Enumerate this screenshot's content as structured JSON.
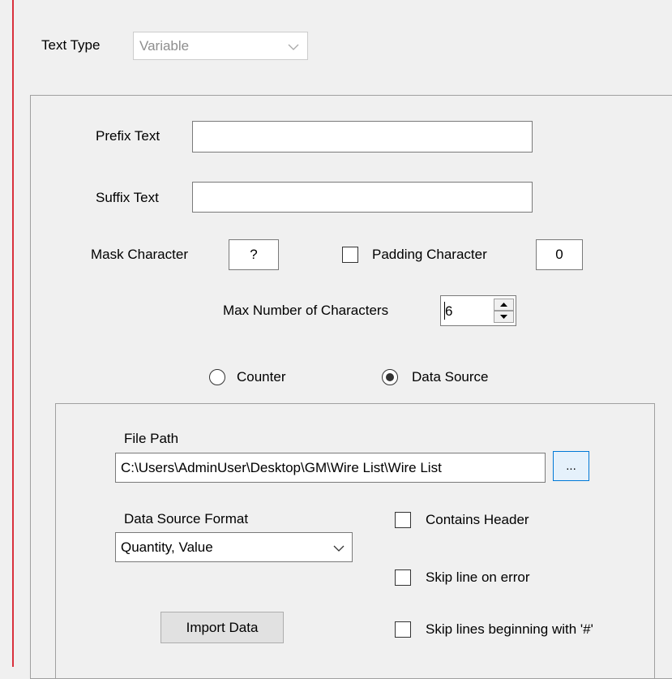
{
  "text_type": {
    "label": "Text Type",
    "value": "Variable"
  },
  "prefix": {
    "label": "Prefix Text",
    "value": ""
  },
  "suffix": {
    "label": "Suffix Text",
    "value": ""
  },
  "mask": {
    "label": "Mask Character",
    "value": "?"
  },
  "padding": {
    "label": "Padding Character",
    "value": "0",
    "checked": false
  },
  "max_chars": {
    "label": "Max Number of Characters",
    "value": "6"
  },
  "mode": {
    "counter_label": "Counter",
    "data_source_label": "Data Source",
    "selected": "data_source"
  },
  "data_source": {
    "file_path_label": "File Path",
    "file_path_value": "C:\\Users\\AdminUser\\Desktop\\GM\\Wire List\\Wire List",
    "browse_label": "...",
    "format_label": "Data Source Format",
    "format_value": "Quantity, Value",
    "contains_header_label": "Contains Header",
    "skip_error_label": "Skip line on error",
    "skip_hash_label": "Skip lines beginning with '#'",
    "import_label": "Import Data"
  }
}
